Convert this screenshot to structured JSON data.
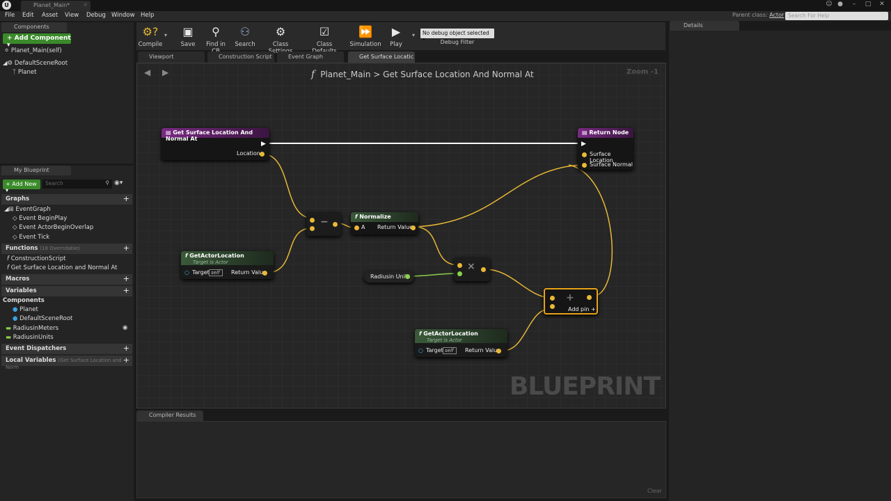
{
  "window": {
    "doc_tab": "Planet_Main*",
    "logo": "U"
  },
  "menu": [
    "File",
    "Edit",
    "Asset",
    "View",
    "Debug",
    "Window",
    "Help"
  ],
  "parent_class": {
    "label": "Parent class:",
    "value": "Actor"
  },
  "help_search": {
    "placeholder": "Search For Help"
  },
  "components": {
    "tab": "Components",
    "add_button": "+ Add Component ▾",
    "self_item": "Planet_Main(self)",
    "tree": [
      "DefaultSceneRoot",
      "Planet"
    ]
  },
  "my_blueprint": {
    "tab": "My Blueprint",
    "add_new": "+ Add New ▾",
    "search_placeholder": "Search",
    "sections": {
      "graphs": "Graphs",
      "event_graph": "EventGraph",
      "events": [
        "Event BeginPlay",
        "Event ActorBeginOverlap",
        "Event Tick"
      ],
      "functions": "Functions",
      "functions_sub": "(18 Overridable)",
      "function_items": [
        "ConstructionScript",
        "Get Surface Location and Normal At"
      ],
      "macros": "Macros",
      "variables": "Variables",
      "components": "Components",
      "component_vars": [
        "Planet",
        "DefaultSceneRoot"
      ],
      "vars": [
        "RadiusinMeters",
        "RadiusinUnits"
      ],
      "event_dispatchers": "Event Dispatchers",
      "local_variables": "Local Variables",
      "local_sub": "(Get Surface Location and Norm"
    }
  },
  "toolbar": {
    "compile": "Compile",
    "save": "Save",
    "find": "Find in CB",
    "search": "Search",
    "class_settings": "Class Settings",
    "class_defaults": "Class Defaults",
    "simulation": "Simulation",
    "play": "Play",
    "debug_select": "No debug object selected ▾",
    "debug_filter": "Debug Filter"
  },
  "graph_tabs": [
    "Viewport",
    "Construction Script",
    "Event Graph",
    "Get Surface Locatic"
  ],
  "graph": {
    "breadcrumb_root": "Planet_Main",
    "breadcrumb_sep": ">",
    "breadcrumb_func": "Get Surface Location And Normal At",
    "zoom": "Zoom -1",
    "watermark": "BLUEPRINT",
    "nodes": {
      "entry": {
        "title": "Get Surface Location And Normal At",
        "pin": "Location"
      },
      "return": {
        "title": "Return Node",
        "pins": [
          "Surface Location",
          "Surface Normal"
        ]
      },
      "normalize": {
        "title": "Normalize",
        "in": "A",
        "out": "Return Value"
      },
      "get_actor_1": {
        "title": "GetActorLocation",
        "sub": "Target is Actor",
        "target": "Target",
        "self": "self",
        "out": "Return Value"
      },
      "get_actor_2": {
        "title": "GetActorLocation",
        "sub": "Target is Actor",
        "target": "Target",
        "self": "self",
        "out": "Return Value"
      },
      "radius": {
        "title": "Radiusin Units"
      },
      "add": {
        "label": "Add pin +"
      }
    },
    "colors": {
      "exec": "#ffffff",
      "vector": "#e8b836",
      "float": "#8bd04a",
      "object": "#38a3e0"
    }
  },
  "compiler": {
    "tab": "Compiler Results",
    "clear": "Clear"
  },
  "details": {
    "tab": "Details"
  }
}
